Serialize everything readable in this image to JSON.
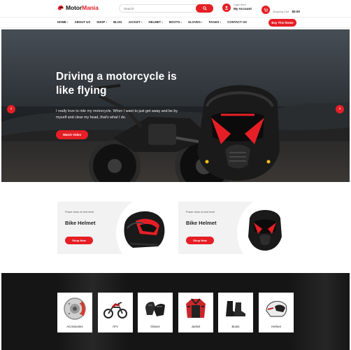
{
  "brand": {
    "name_part1": "Motor",
    "name_part2": "Mania",
    "accent": "#e51f25"
  },
  "search": {
    "placeholder": "Search",
    "icon": "search-icon"
  },
  "account": {
    "line1": "Login Here",
    "line2": "My Account",
    "icon": "user-icon"
  },
  "cart": {
    "line1": "Shopping Cart",
    "line2": "$0.00",
    "icon": "cart-icon"
  },
  "nav": {
    "items": [
      {
        "label": "HOME",
        "dropdown": true
      },
      {
        "label": "ABOUT US",
        "dropdown": false
      },
      {
        "label": "SHOP",
        "dropdown": true
      },
      {
        "label": "BLOG",
        "dropdown": false
      },
      {
        "label": "JACKET",
        "dropdown": true
      },
      {
        "label": "HELMET",
        "dropdown": true
      },
      {
        "label": "BOOTS",
        "dropdown": true
      },
      {
        "label": "GLOVES",
        "dropdown": true
      },
      {
        "label": "PAGES",
        "dropdown": true
      },
      {
        "label": "CONTACT US",
        "dropdown": false
      }
    ],
    "cta": "Buy This theme"
  },
  "hero": {
    "title": "Driving a motorcycle is like flying",
    "text": "I really love to ride my motorcycle. When I want to just get away and be by myself and clear my head, that's what I do.",
    "button": "Watch Video",
    "prev_icon": "chevron-left-icon",
    "next_icon": "chevron-right-icon"
  },
  "promos": [
    {
      "eyebrow": "Power tools of next level",
      "title": "Bike Helmet",
      "button": "Shop Now"
    },
    {
      "eyebrow": "Power tools of next level",
      "title": "Bike Helmet",
      "button": "Shop Now"
    }
  ],
  "categories": [
    {
      "label": "Accessories",
      "icon": "brake-disc-icon"
    },
    {
      "label": "ATV",
      "icon": "motorcycle-icon"
    },
    {
      "label": "Gloves",
      "icon": "gloves-icon"
    },
    {
      "label": "Jacket",
      "icon": "jacket-icon"
    },
    {
      "label": "Boots",
      "icon": "boots-icon"
    },
    {
      "label": "Helmet",
      "icon": "helmet-icon"
    }
  ]
}
